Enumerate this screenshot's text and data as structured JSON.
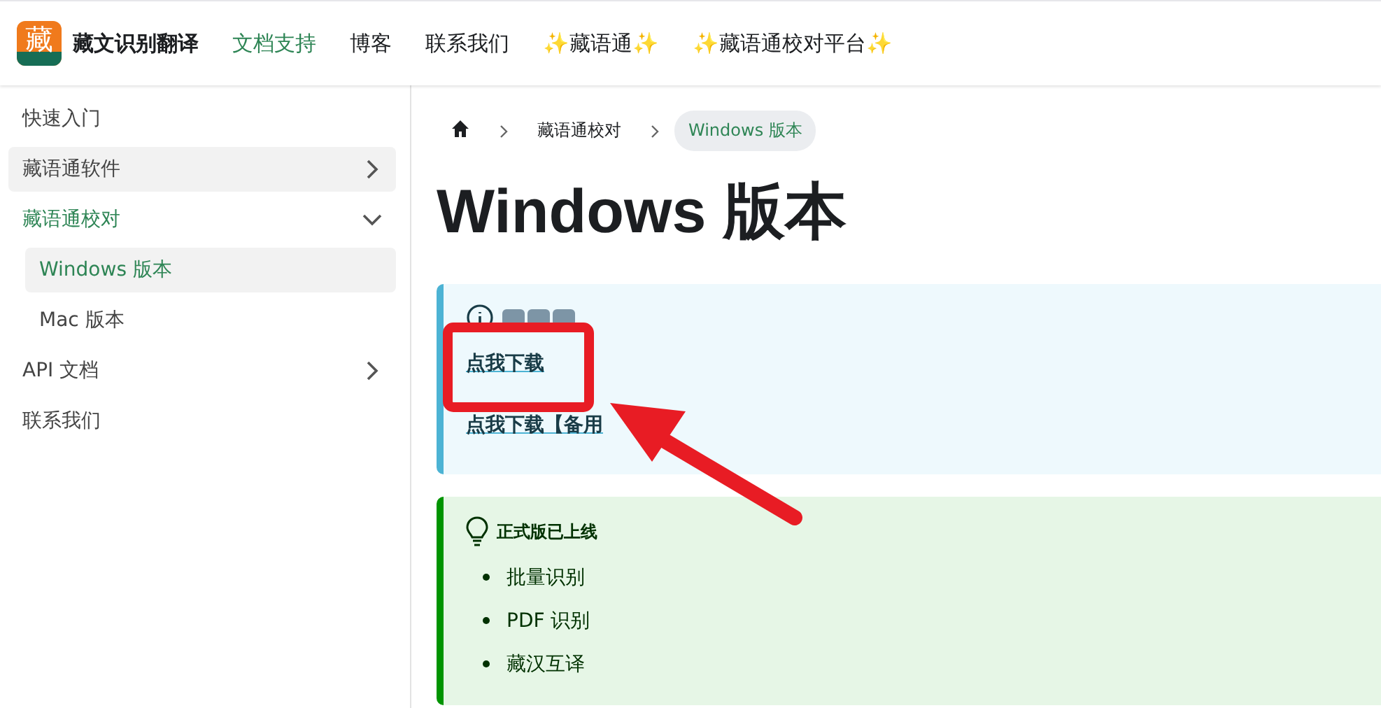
{
  "navbar": {
    "logo": "藏",
    "brand": "藏文识别翻译",
    "links": [
      {
        "label": "文档支持",
        "selected": true
      },
      {
        "label": "博客",
        "selected": false
      },
      {
        "label": "联系我们",
        "selected": false
      },
      {
        "label": "✨藏语通✨",
        "selected": false
      },
      {
        "label": "✨藏语通校对平台✨",
        "selected": false
      }
    ]
  },
  "sidebar": {
    "items": [
      {
        "label": "快速入门",
        "selected": false
      },
      {
        "label": "藏语通软件",
        "selected": false,
        "highlighted": true,
        "expanded": false
      },
      {
        "label": "藏语通校对",
        "selected": true,
        "expanded": true,
        "children": [
          {
            "label": "Windows 版本",
            "selected": true
          },
          {
            "label": "Mac 版本",
            "selected": false
          }
        ]
      },
      {
        "label": "API 文档",
        "selected": false,
        "expanded": false
      },
      {
        "label": "联系我们",
        "selected": false
      }
    ]
  },
  "breadcrumbs": [
    {
      "kind": "home"
    },
    {
      "kind": "text",
      "label": "藏语通校对",
      "selected": false
    },
    {
      "kind": "text",
      "label": "Windows 版本",
      "selected": true
    }
  ],
  "title": "Windows 版本",
  "admonitions": [
    {
      "kind": "info",
      "links": [
        "点我下载",
        "点我下载【备用"
      ]
    },
    {
      "kind": "tip",
      "title": "正式版已上线",
      "items": [
        "批量识别",
        "PDF 识别",
        "藏汉互译"
      ]
    }
  ]
}
